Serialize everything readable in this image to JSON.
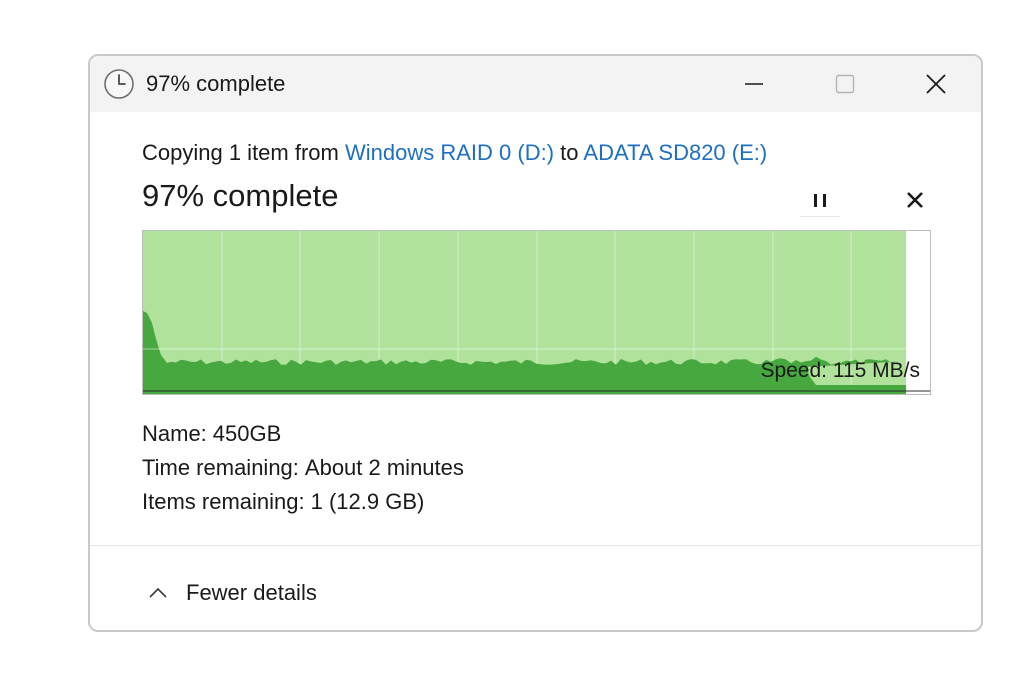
{
  "window": {
    "title": "97% complete",
    "title_icon": "clock-icon"
  },
  "progress": {
    "copying_prefix": "Copying 1 item from",
    "source": "Windows RAID 0 (D:)",
    "connector": "to",
    "destination": "ADATA SD820 (E:)",
    "heading": "97% complete",
    "percent": 97
  },
  "controls": {
    "pause_icon": "pause-icon",
    "cancel_icon": "close-icon"
  },
  "graph": {
    "speed_label": "Speed:",
    "speed_value": "115 MB/s",
    "colors": {
      "completed_fill": "#b0e29c",
      "throughput_fill": "#46a83e",
      "gridline": "#d6edcc"
    }
  },
  "details": {
    "name_label": "Name:",
    "name_value": "450GB",
    "time_label": "Time remaining:",
    "time_value": "About 2 minutes",
    "items_label": "Items remaining:",
    "items_value": "1 (12.9 GB)"
  },
  "footer": {
    "toggle_label": "Fewer details",
    "toggle_icon": "chevron-up-icon"
  }
}
